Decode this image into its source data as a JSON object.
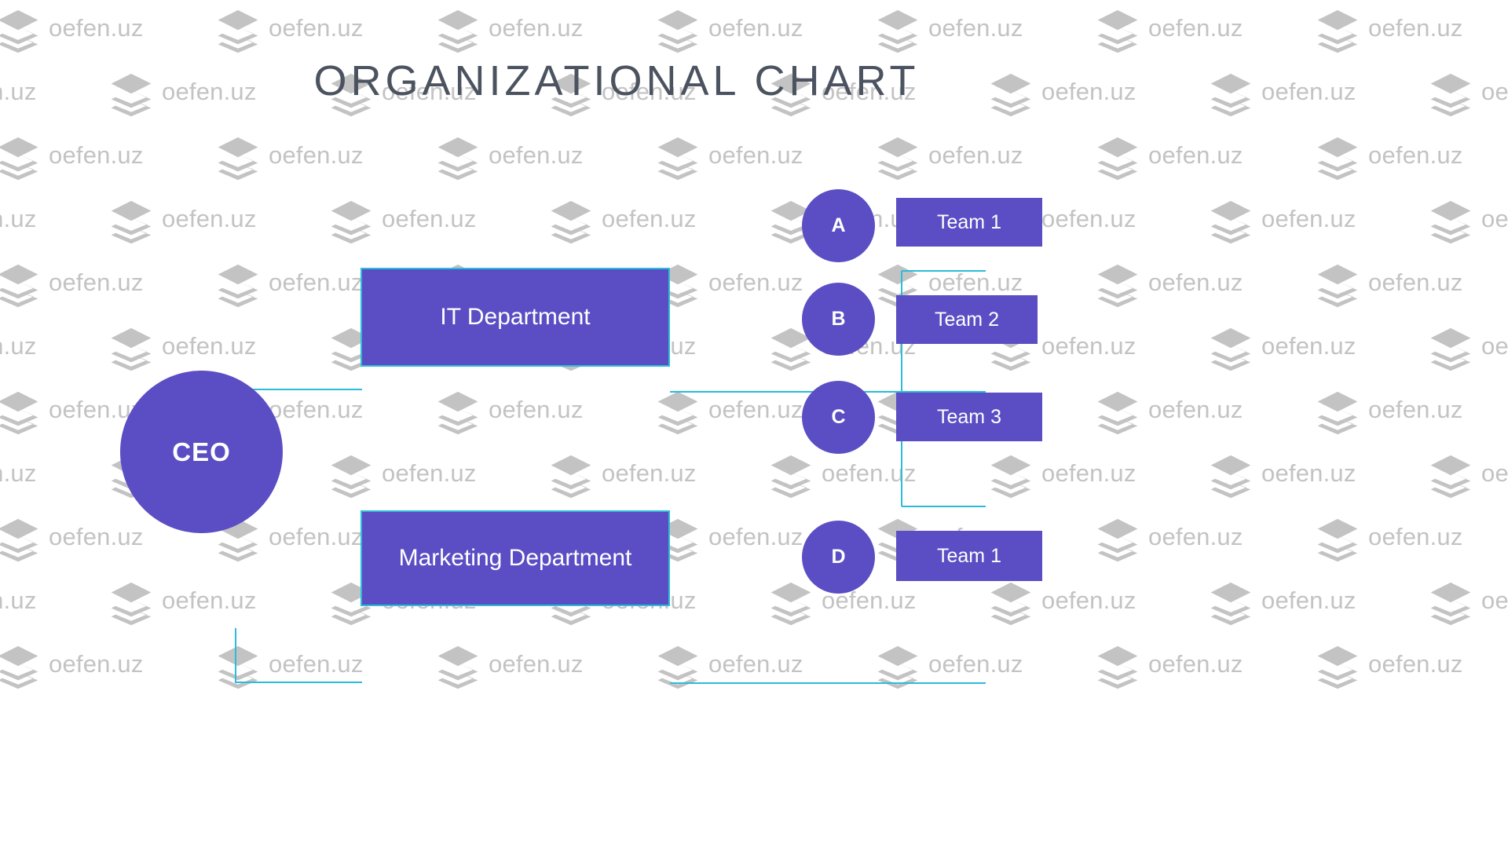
{
  "page": {
    "title": "ORGANIZATIONAL CHART",
    "background": "#ffffff"
  },
  "theme": {
    "node_fill": "#5b4ec4",
    "connector": "#2bbcd8",
    "node_text": "#ffffff",
    "title_color": "#4c5360",
    "watermark_color": "#c3c3c3"
  },
  "watermark": {
    "text": "oefen.uz",
    "icon": "stacked-layers-logo-icon",
    "columns": 7,
    "rows": 11
  },
  "chart_data": {
    "type": "diagram",
    "diagram_kind": "organizational-chart",
    "orientation": "left-to-right",
    "title": "ORGANIZATIONAL CHART",
    "nodes": [
      {
        "id": "ceo",
        "label": "CEO",
        "shape": "circle",
        "level": 0
      },
      {
        "id": "it",
        "label": "IT Department",
        "shape": "rectangle",
        "level": 1
      },
      {
        "id": "marketing",
        "label": "Marketing Department",
        "shape": "rectangle",
        "level": 1
      },
      {
        "id": "a",
        "label": "A",
        "shape": "circle",
        "level": 2
      },
      {
        "id": "b",
        "label": "B",
        "shape": "circle",
        "level": 2
      },
      {
        "id": "c",
        "label": "C",
        "shape": "circle",
        "level": 2
      },
      {
        "id": "d",
        "label": "D",
        "shape": "circle",
        "level": 2
      },
      {
        "id": "team_a",
        "label": "Team 1",
        "shape": "rectangle",
        "level": 3
      },
      {
        "id": "team_b",
        "label": "Team 2",
        "shape": "rectangle",
        "level": 3
      },
      {
        "id": "team_c",
        "label": "Team 3",
        "shape": "rectangle",
        "level": 3
      },
      {
        "id": "team_d",
        "label": "Team 1",
        "shape": "rectangle",
        "level": 3
      }
    ],
    "edges": [
      {
        "from": "ceo",
        "to": "it"
      },
      {
        "from": "ceo",
        "to": "marketing"
      },
      {
        "from": "it",
        "to": "a"
      },
      {
        "from": "it",
        "to": "b"
      },
      {
        "from": "it",
        "to": "c"
      },
      {
        "from": "marketing",
        "to": "d"
      },
      {
        "from": "a",
        "to": "team_a"
      },
      {
        "from": "b",
        "to": "team_b"
      },
      {
        "from": "c",
        "to": "team_c"
      },
      {
        "from": "d",
        "to": "team_d"
      }
    ]
  },
  "nodes": {
    "ceo": "CEO",
    "it_department": "IT Department",
    "marketing_department": "Marketing Department",
    "unit_a": "A",
    "unit_b": "B",
    "unit_c": "C",
    "unit_d": "D",
    "team_1a": "Team 1",
    "team_2": "Team 2",
    "team_3": "Team 3",
    "team_1d": "Team 1"
  }
}
